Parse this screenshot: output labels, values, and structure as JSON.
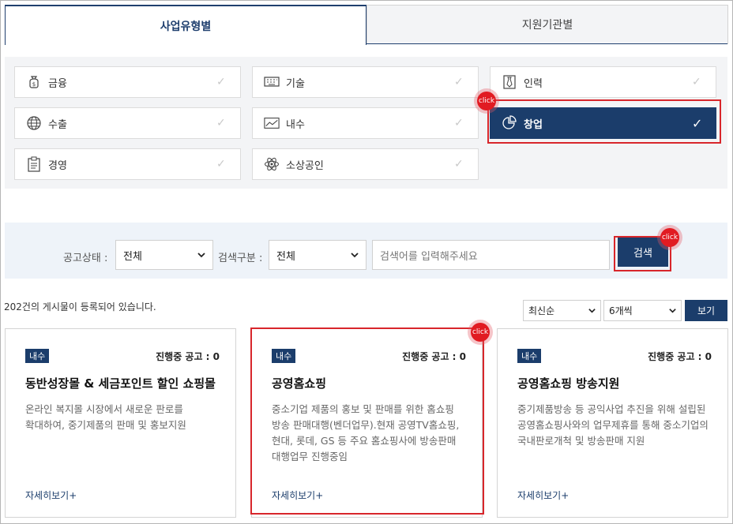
{
  "tabs": [
    {
      "label": "사업유형별",
      "active": true
    },
    {
      "label": "지원기관별",
      "active": false
    }
  ],
  "categories": [
    {
      "label": "금융",
      "icon": "money-bag-icon",
      "selected": false
    },
    {
      "label": "기술",
      "icon": "keyboard-icon",
      "selected": false
    },
    {
      "label": "인력",
      "icon": "necktie-icon",
      "selected": false
    },
    {
      "label": "수출",
      "icon": "globe-icon",
      "selected": false
    },
    {
      "label": "내수",
      "icon": "line-chart-icon",
      "selected": false
    },
    {
      "label": "창업",
      "icon": "pie-chart-icon",
      "selected": true
    },
    {
      "label": "경영",
      "icon": "clipboard-icon",
      "selected": false
    },
    {
      "label": "소상공인",
      "icon": "atom-icon",
      "selected": false
    }
  ],
  "search": {
    "status_label": "공고상태 :",
    "status_value": "전체",
    "type_label": "검색구분 :",
    "type_value": "전체",
    "placeholder": "검색어를 입력해주세요",
    "button_label": "검색"
  },
  "annotations": {
    "click": "click"
  },
  "list": {
    "count_text": "202건의 게시물이 등록되어 있습니다.",
    "sort_value": "최신순",
    "per_page_value": "6개씩",
    "view_button": "보기"
  },
  "cards": [
    {
      "badge": "내수",
      "status": "진행중 공고 : 0",
      "title": "동반성장몰 & 세금포인트 할인 쇼핑몰",
      "desc": "온라인 복지몰 시장에서 새로운 판로를 확대하여, 중기제품의 판매 및 홍보지원",
      "more": "자세히보기+"
    },
    {
      "badge": "내수",
      "status": "진행중 공고 : 0",
      "title": "공영홈쇼핑",
      "desc": "중소기업 제품의 홍보 및 판매를 위한 홈쇼핑 방송 판매대행(벤더업무).현재 공영TV홈쇼핑, 현대, 롯데, GS 등 주요 홈쇼핑사에 방송판매 대행업무 진행중임",
      "more": "자세히보기+"
    },
    {
      "badge": "내수",
      "status": "진행중 공고 : 0",
      "title": "공영홈쇼핑 방송지원",
      "desc": "중기제품방송 등 공익사업 추진을 위해 설립된 공영홈쇼핑사와의 업무제휴를 통해 중소기업의 국내판로개척 및 방송판매 지원",
      "more": "자세히보기+"
    }
  ],
  "colors": {
    "accent": "#1b3d6b",
    "highlight": "#d8262b",
    "panel": "#f3f4f6",
    "searchbar": "#eef3f9"
  }
}
